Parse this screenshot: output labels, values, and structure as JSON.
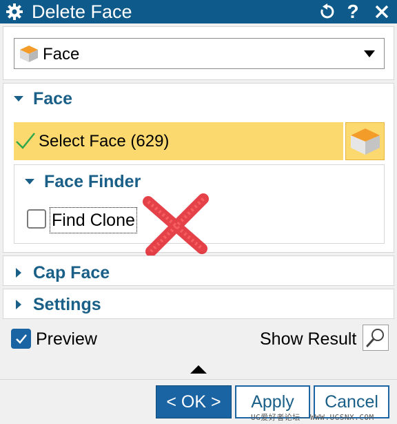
{
  "window": {
    "title": "Delete Face"
  },
  "type_dropdown": {
    "selected": "Face"
  },
  "face_section": {
    "header": "Face",
    "select_face_label": "Select Face (629)",
    "face_finder": {
      "header": "Face Finder",
      "find_clone_label": "Find Clone",
      "find_clone_checked": false
    }
  },
  "cap_face_section": {
    "header": "Cap Face"
  },
  "settings_section": {
    "header": "Settings"
  },
  "preview": {
    "label": "Preview",
    "checked": true,
    "show_result_label": "Show Result"
  },
  "buttons": {
    "ok": "< OK >",
    "apply": "Apply",
    "cancel": "Cancel"
  },
  "watermark": "UG爱好者论坛--WWW.UGSNX.COM",
  "colors": {
    "title_bar": "#0e5a8a",
    "section_header": "#1a5f87",
    "highlight": "#fbd96f",
    "primary_button": "#1b64a4"
  },
  "icons": [
    "gear-icon",
    "reset-icon",
    "help-icon",
    "close-icon",
    "face-cube-icon",
    "dropdown-arrow-icon",
    "checkmark-icon",
    "magnifier-icon",
    "collapse-arrow-icon",
    "red-x-mark-icon"
  ]
}
